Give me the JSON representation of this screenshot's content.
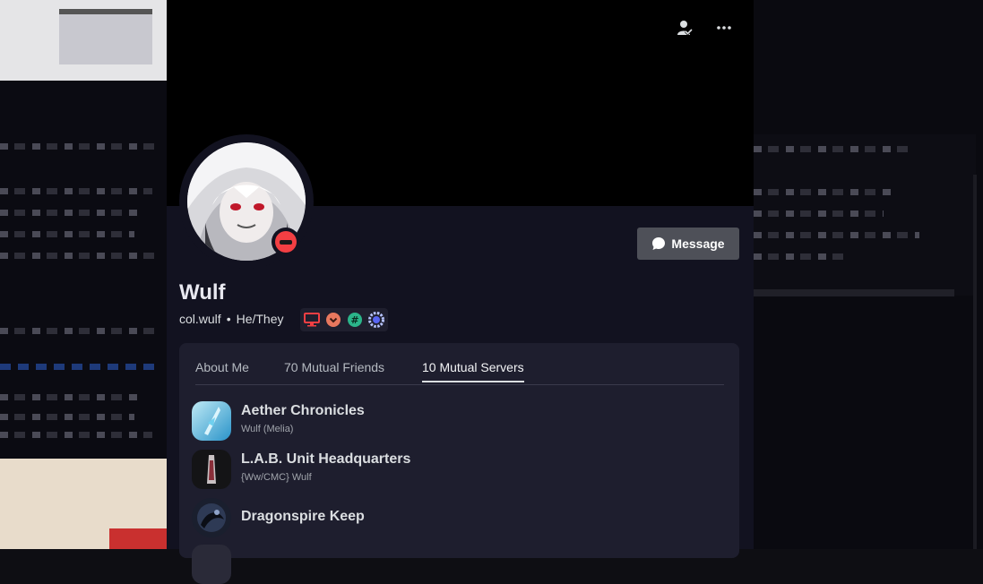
{
  "profile": {
    "display_name": "Wulf",
    "username": "col.wulf",
    "separator": "•",
    "pronouns": "He/They",
    "status": "do-not-disturb",
    "badges": [
      "desktop-icon",
      "heart-icon",
      "hashtag-icon",
      "gear-badge-icon"
    ]
  },
  "actions": {
    "message_label": "Message",
    "message_icon": "chat-bubble-icon",
    "friend_icon": "friend-check-icon",
    "more_icon": "more-icon"
  },
  "tabs": [
    {
      "label": "About Me",
      "active": false
    },
    {
      "label": "70 Mutual Friends",
      "active": false
    },
    {
      "label": "10 Mutual Servers",
      "active": true
    }
  ],
  "servers": [
    {
      "name": "Aether Chronicles",
      "nickname": "Wulf (Melia)"
    },
    {
      "name": "L.A.B. Unit Headquarters",
      "nickname": "{Ww/CMC} Wulf"
    },
    {
      "name": "Dragonspire Keep",
      "nickname": ""
    }
  ],
  "colors": {
    "card_bg": "#121220",
    "banner_bg": "#000000",
    "button_bg": "#4e5058",
    "dnd_red": "#f23f43"
  }
}
